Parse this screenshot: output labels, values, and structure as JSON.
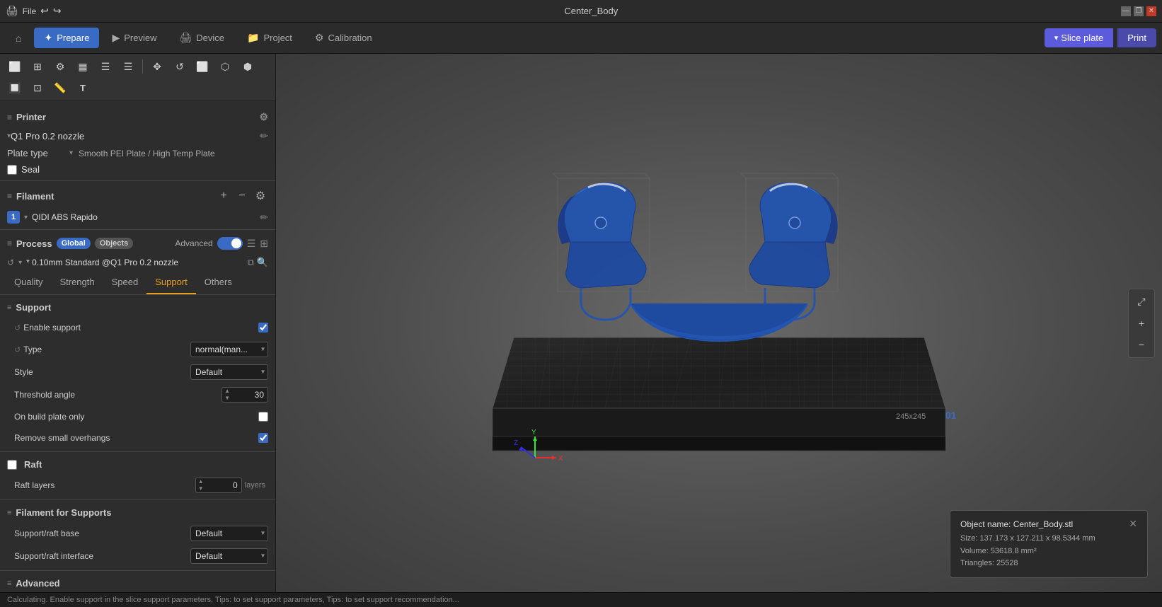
{
  "titleBar": {
    "title": "Center_Body",
    "file_label": "File",
    "minimize": "—",
    "restore": "❐",
    "close": "✕"
  },
  "nav": {
    "tabs": [
      {
        "id": "home",
        "label": "Home",
        "icon": "⌂",
        "active": false
      },
      {
        "id": "prepare",
        "label": "Prepare",
        "icon": "✦",
        "active": true
      },
      {
        "id": "preview",
        "label": "Preview",
        "icon": "▶",
        "active": false
      },
      {
        "id": "device",
        "label": "Device",
        "icon": "🖨",
        "active": false
      },
      {
        "id": "project",
        "label": "Project",
        "icon": "📁",
        "active": false
      },
      {
        "id": "calibration",
        "label": "Calibration",
        "icon": "⚙",
        "active": false
      }
    ],
    "slice_label": "Slice plate",
    "print_label": "Print"
  },
  "sidebar": {
    "printer": {
      "section_icon": "≡",
      "label": "Printer",
      "name": "Q1 Pro 0.2 nozzle"
    },
    "plate_type": {
      "label": "Plate type",
      "value": "Smooth PEI Plate / High Temp Plate"
    },
    "seal": {
      "label": "Seal",
      "checked": false
    },
    "filament": {
      "label": "Filament",
      "section_icon": "≡",
      "items": [
        {
          "num": "1",
          "name": "QIDI ABS Rapido"
        }
      ]
    },
    "process": {
      "label": "Process",
      "section_icon": "≡",
      "badge_global": "Global",
      "badge_objects": "Objects",
      "advanced_label": "Advanced",
      "profile": "* 0.10mm Standard @Q1 Pro 0.2 nozzle"
    },
    "tabs": [
      "Quality",
      "Strength",
      "Speed",
      "Support",
      "Others"
    ],
    "active_tab": "Support",
    "support": {
      "group_label": "Support",
      "enable_support": {
        "label": "Enable support",
        "checked": true
      },
      "type": {
        "label": "Type",
        "value": "normal(man..."
      },
      "style": {
        "label": "Style",
        "value": "Default"
      },
      "threshold_angle": {
        "label": "Threshold angle",
        "value": "30",
        "unit": ""
      },
      "on_build_plate": {
        "label": "On build plate only",
        "checked": false
      },
      "remove_small": {
        "label": "Remove small overhangs",
        "checked": true
      }
    },
    "raft": {
      "group_label": "Raft",
      "layers": {
        "label": "Raft layers",
        "value": "0",
        "suffix": "layers"
      }
    },
    "filament_supports": {
      "group_label": "Filament for Supports",
      "support_raft_base": {
        "label": "Support/raft base",
        "value": "Default"
      },
      "support_raft_interface": {
        "label": "Support/raft interface",
        "value": "Default"
      }
    },
    "advanced": {
      "group_label": "Advanced"
    }
  },
  "viewport": {
    "plate_size": "245x245",
    "plate_number": "01",
    "axis": {
      "x_color": "#e83030",
      "y_color": "#30e830",
      "z_color": "#3030e8"
    }
  },
  "obj_info": {
    "name_label": "Object name:",
    "name_value": "Center_Body.stl",
    "size_label": "Size:",
    "size_value": "137.173 x 127.211 x 98.5344 mm",
    "volume_label": "Volume:",
    "volume_value": "53618.8 mm²",
    "triangles_label": "Triangles:",
    "triangles_value": "25528"
  },
  "status_bar": {
    "message": "Calculating. Enable support in the slice support parameters, Tips: to set support parameters, Tips: to set support recommendation..."
  },
  "toolbar": {
    "tools": [
      "⬜",
      "⊞",
      "⚙",
      "▦",
      "☰",
      "☰",
      "|",
      "✥",
      "◯",
      "⬜",
      "⬡",
      "⬢",
      "🔲",
      "⬜",
      "⬜",
      "⬜",
      "T",
      "⤢",
      "⊞",
      "📏",
      "⬜",
      "✏"
    ]
  }
}
